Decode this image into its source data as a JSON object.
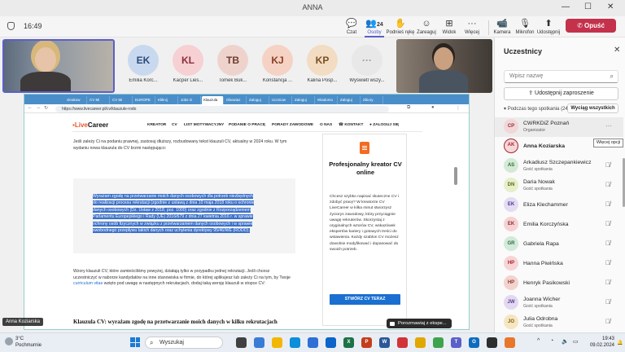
{
  "window": {
    "title": "ANNA"
  },
  "toolbar": {
    "time": "16:49",
    "buttons": [
      {
        "label": "Czat",
        "icon": "chat-icon"
      },
      {
        "label": "Osoby",
        "icon": "people-icon",
        "count": "24",
        "active": true
      },
      {
        "label": "Podnieś rękę",
        "icon": "raise-hand-icon"
      },
      {
        "label": "Zareaguj",
        "icon": "react-icon"
      },
      {
        "label": "Widok",
        "icon": "view-icon"
      },
      {
        "label": "Więcej",
        "icon": "more-icon"
      },
      {
        "label": "Kamera",
        "icon": "camera-icon"
      },
      {
        "label": "Mikrofon",
        "icon": "mic-off-icon"
      },
      {
        "label": "Udostępnij",
        "icon": "share-icon"
      }
    ],
    "leave_label": "Opuść"
  },
  "gallery": [
    {
      "initials": "EK",
      "name": "Emilia Korc...",
      "bg": "#c8d9ef",
      "fg": "#2c4a7a"
    },
    {
      "initials": "KL",
      "name": "Kacper Lies...",
      "bg": "#f6d0d3",
      "fg": "#8a2f3a"
    },
    {
      "initials": "TB",
      "name": "Tomek Buk...",
      "bg": "#eed3cd",
      "fg": "#6d3b30"
    },
    {
      "initials": "KJ",
      "name": "Konstancja ...",
      "bg": "#f5d2c4",
      "fg": "#8a3f22"
    },
    {
      "initials": "KP",
      "name": "Kalina Posp...",
      "bg": "#f2dcc2",
      "fg": "#7a4e1f"
    },
    {
      "initials": "···",
      "name": "Wyświetl wszy...",
      "bg": "#e8e8e8",
      "fg": "#9a9a9a"
    }
  ],
  "browser": {
    "tabs": [
      "ckrakow",
      "CV Mi",
      "CV Mi",
      "EUROPE",
      "Kliknij",
      "Jobs G",
      "Klauzula",
      "Obowiaz",
      "Zaloguj",
      "Uczniow",
      "Zaloguj",
      "Wiadomo",
      "Zaloguj",
      "Zbiory"
    ],
    "url": "https://www.livecareer.pl/cv/klauzule-rodo"
  },
  "site": {
    "logo_prefix": "Live",
    "logo_suffix": "Career",
    "menu": [
      "KREATOR",
      "CV",
      "LIST MOTYWACYJNY",
      "PODANIE O PRACĘ",
      "PORADY ZAWODOWE",
      "O NAS",
      "KONTAKT",
      "ZALOGUJ SIĘ"
    ],
    "intro": "Jeśli zależy Ci na podaniu prawnej, zastosuj dłuższy, rozbudowany tekst klauzuli CV, aktualny w 2024 roku. W tym wydaniu nowa klauzula do CV brzmi następująco:",
    "quote_lines": [
      "Wyrażam zgodę na przetwarzanie moich danych osobowych dla potrzeb niezbędnych",
      "do realizacji procesu rekrutacji (zgodnie z ustawą z dnia 10 maja 2018 roku o ochronie",
      "danych osobowych (Dz. Ustaw z 2018, poz. 1000) oraz zgodnie z Rozporządzeniem",
      "Parlamentu Europejskiego i Rady (UE) 2016/679 z dnia 27 kwietnia 2016 r. w sprawie",
      "ochrony osób fizycznych w związku z przetwarzaniem danych osobowych i w sprawie",
      "swobodnego przepływu takich danych oraz uchylenia dyrektywy 95/46/WE (RODO)."
    ],
    "para2_a": "Wzory klauzuli CV, które zamieściliśmy powyżej, działają tylko w przypadku jednej rekrutacji. Jeśli chcesz uczestniczyć w naborze kandydatów na inne stanowiska w firmie, do której aplikujesz lub zależy Ci na tym, by Twoje ",
    "para2_link": "curriculum vitae",
    "para2_b": " wzięto pod uwagę w następnych rekrutacjach, dodaj taką wersję klauzuli w stopce CV:",
    "heading2": "Klauzula CV: wyrażam zgodę na przetwarzanie moich danych w kilku rekrutacjach",
    "promo_title": "Profesjonalny kreator CV online",
    "promo_body": "Chcesz szybko napisać skuteczne CV i zdobyć pracę? W kreatorze CV LiveCareer w kilka minut stworzysz życiorys zawodowy, który przyciągnie uwagę rekruterów. Skorzystaj z oryginalnych wzorów CV, wskazówek ekspertów kariery i gotowych treści do wstawienia. Każdy szablon CV możesz dowolnie modyfikować i dopasować do swoich potrzeb.",
    "promo_cta": "STWÓRZ CV TERAZ"
  },
  "presenter_name": "Anna Koziarska",
  "chat_notification": "Porozmawiaj z ekspe...",
  "participants": {
    "title": "Uczestnicy",
    "search_placeholder": "Wpisz nazwę",
    "invite_label": "Udostępnij zaproszenie",
    "section_label": "Podczas tego spotkania (24)",
    "admit_all_label": "Wyciąg wszystkich",
    "tooltip": "Więcej opcji",
    "list": [
      {
        "initials": "CP",
        "name": "CWRKDiZ Poznań",
        "role": "Organizator",
        "bg": "#f3d6d8",
        "fg": "#8a2f3a"
      },
      {
        "initials": "AK",
        "name": "Anna Koziarska",
        "role": "",
        "bg": "#f7d7d9",
        "fg": "#a4262c"
      },
      {
        "initials": "AS",
        "name": "Arkadiusz Szczepankiewicz",
        "role": "Gość spotkania",
        "bg": "#d4ead6",
        "fg": "#2f6a35"
      },
      {
        "initials": "DN",
        "name": "Daria Nowak",
        "role": "Gość spotkania",
        "bg": "#e6efc9",
        "fg": "#5a6b1e"
      },
      {
        "initials": "EK",
        "name": "Eliza Klechammer",
        "role": "",
        "bg": "#e3dcf3",
        "fg": "#4b3a8a"
      },
      {
        "initials": "EK",
        "name": "Emilia Korczyńska",
        "role": "",
        "bg": "#f6d2d3",
        "fg": "#8a2f3a"
      },
      {
        "initials": "GR",
        "name": "Gabriela Rapa",
        "role": "",
        "bg": "#d2ead9",
        "fg": "#2f6a45"
      },
      {
        "initials": "HP",
        "name": "Hanna Piwińska",
        "role": "",
        "bg": "#f7d4d6",
        "fg": "#a4262c"
      },
      {
        "initials": "HP",
        "name": "Henryk Pasikowski",
        "role": "",
        "bg": "#f3d3ce",
        "fg": "#8a3b2f"
      },
      {
        "initials": "JW",
        "name": "Joanna Wicher",
        "role": "Gość spotkania",
        "bg": "#e2d8f1",
        "fg": "#5a3a8a"
      },
      {
        "initials": "JO",
        "name": "Julia Odrobna",
        "role": "Gość spotkania",
        "bg": "#f5e6bf",
        "fg": "#7a5a12"
      }
    ]
  },
  "taskbar": {
    "temp": "3°C",
    "weather": "Pochmurnie",
    "search_label": "Wyszukaj",
    "time": "19:43",
    "date": "09.02.2024",
    "apps": [
      {
        "name": "task-view-icon",
        "color": "#404040",
        "glyph": ""
      },
      {
        "name": "widgets-icon",
        "color": "#3a7bd5",
        "glyph": ""
      },
      {
        "name": "file-explorer-icon",
        "color": "#f2b705",
        "glyph": ""
      },
      {
        "name": "edge-icon",
        "color": "#0c8ed9",
        "glyph": ""
      },
      {
        "name": "store-icon",
        "color": "#2f6fd6",
        "glyph": ""
      },
      {
        "name": "mail-icon",
        "color": "#0a64c9",
        "glyph": ""
      },
      {
        "name": "excel-icon",
        "color": "#1e7145",
        "glyph": "X"
      },
      {
        "name": "powerpoint-icon",
        "color": "#c43e1c",
        "glyph": "P"
      },
      {
        "name": "word-icon",
        "color": "#2b579a",
        "glyph": "W"
      },
      {
        "name": "app-red-icon",
        "color": "#d13438",
        "glyph": ""
      },
      {
        "name": "chrome-icon",
        "color": "#e0a800",
        "glyph": ""
      },
      {
        "name": "app-green-icon",
        "color": "#3fa34d",
        "glyph": ""
      },
      {
        "name": "teams-icon",
        "color": "#5b5fc7",
        "glyph": "T"
      },
      {
        "name": "outlook-icon",
        "color": "#0f6cbd",
        "glyph": "O"
      },
      {
        "name": "app-dark-icon",
        "color": "#2d2d2d",
        "glyph": ""
      },
      {
        "name": "app-orange-icon",
        "color": "#e8762b",
        "glyph": ""
      }
    ]
  }
}
